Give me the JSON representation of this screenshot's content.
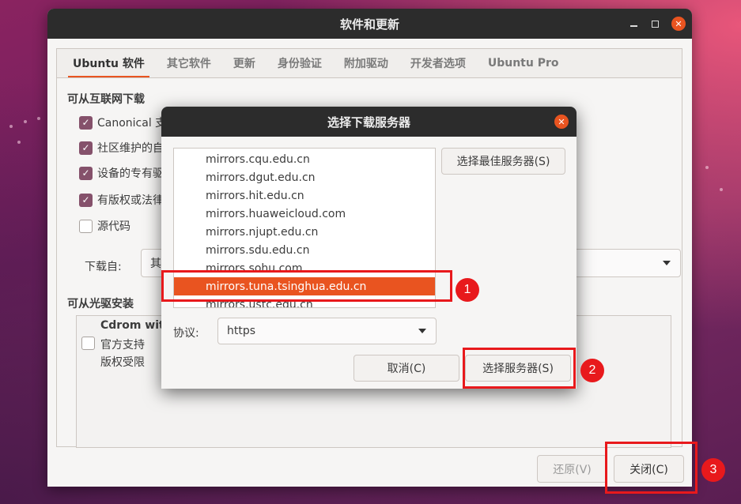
{
  "main_window": {
    "title": "软件和更新",
    "tabs": [
      {
        "label": "Ubuntu 软件",
        "active": true
      },
      {
        "label": "其它软件",
        "active": false
      },
      {
        "label": "更新",
        "active": false
      },
      {
        "label": "身份验证",
        "active": false
      },
      {
        "label": "附加驱动",
        "active": false
      },
      {
        "label": "开发者选项",
        "active": false
      },
      {
        "label": "Ubuntu Pro",
        "active": false
      }
    ],
    "internet_section_title": "可从互联网下载",
    "checkboxes": [
      {
        "label": "Canonical 支",
        "checked": true
      },
      {
        "label": "社区维护的自",
        "checked": true
      },
      {
        "label": "设备的专有驱",
        "checked": true
      },
      {
        "label": "有版权或法律",
        "checked": true
      },
      {
        "label": "源代码",
        "checked": false
      }
    ],
    "download_from_label": "下载自:",
    "download_from_value": "其它",
    "cdrom_section_title": "可从光驱安装",
    "cdrom": {
      "name": "Cdrom with",
      "line1": "官方支持",
      "line2": "版权受限"
    },
    "revert_button": "还原(V)",
    "close_button": "关闭(C)"
  },
  "dialog": {
    "title": "选择下载服务器",
    "servers": [
      "mirrors.cqu.edu.cn",
      "mirrors.dgut.edu.cn",
      "mirrors.hit.edu.cn",
      "mirrors.huaweicloud.com",
      "mirrors.njupt.edu.cn",
      "mirrors.sdu.edu.cn",
      "mirrors.sohu.com",
      "mirrors.tuna.tsinghua.edu.cn",
      "mirrors.ustc.edu.cn"
    ],
    "selected_server": "mirrors.tuna.tsinghua.edu.cn",
    "best_server_button": "选择最佳服务器(S)",
    "protocol_label": "协议:",
    "protocol_value": "https",
    "cancel_button": "取消(C)",
    "choose_button": "选择服务器(S)"
  },
  "annotations": {
    "step1": "1",
    "step2": "2",
    "step3": "3"
  },
  "colors": {
    "accent": "#e95420",
    "checkbox": "#85516b",
    "annotation_red": "#e8191c",
    "titlebar": "#2c2c2c"
  }
}
